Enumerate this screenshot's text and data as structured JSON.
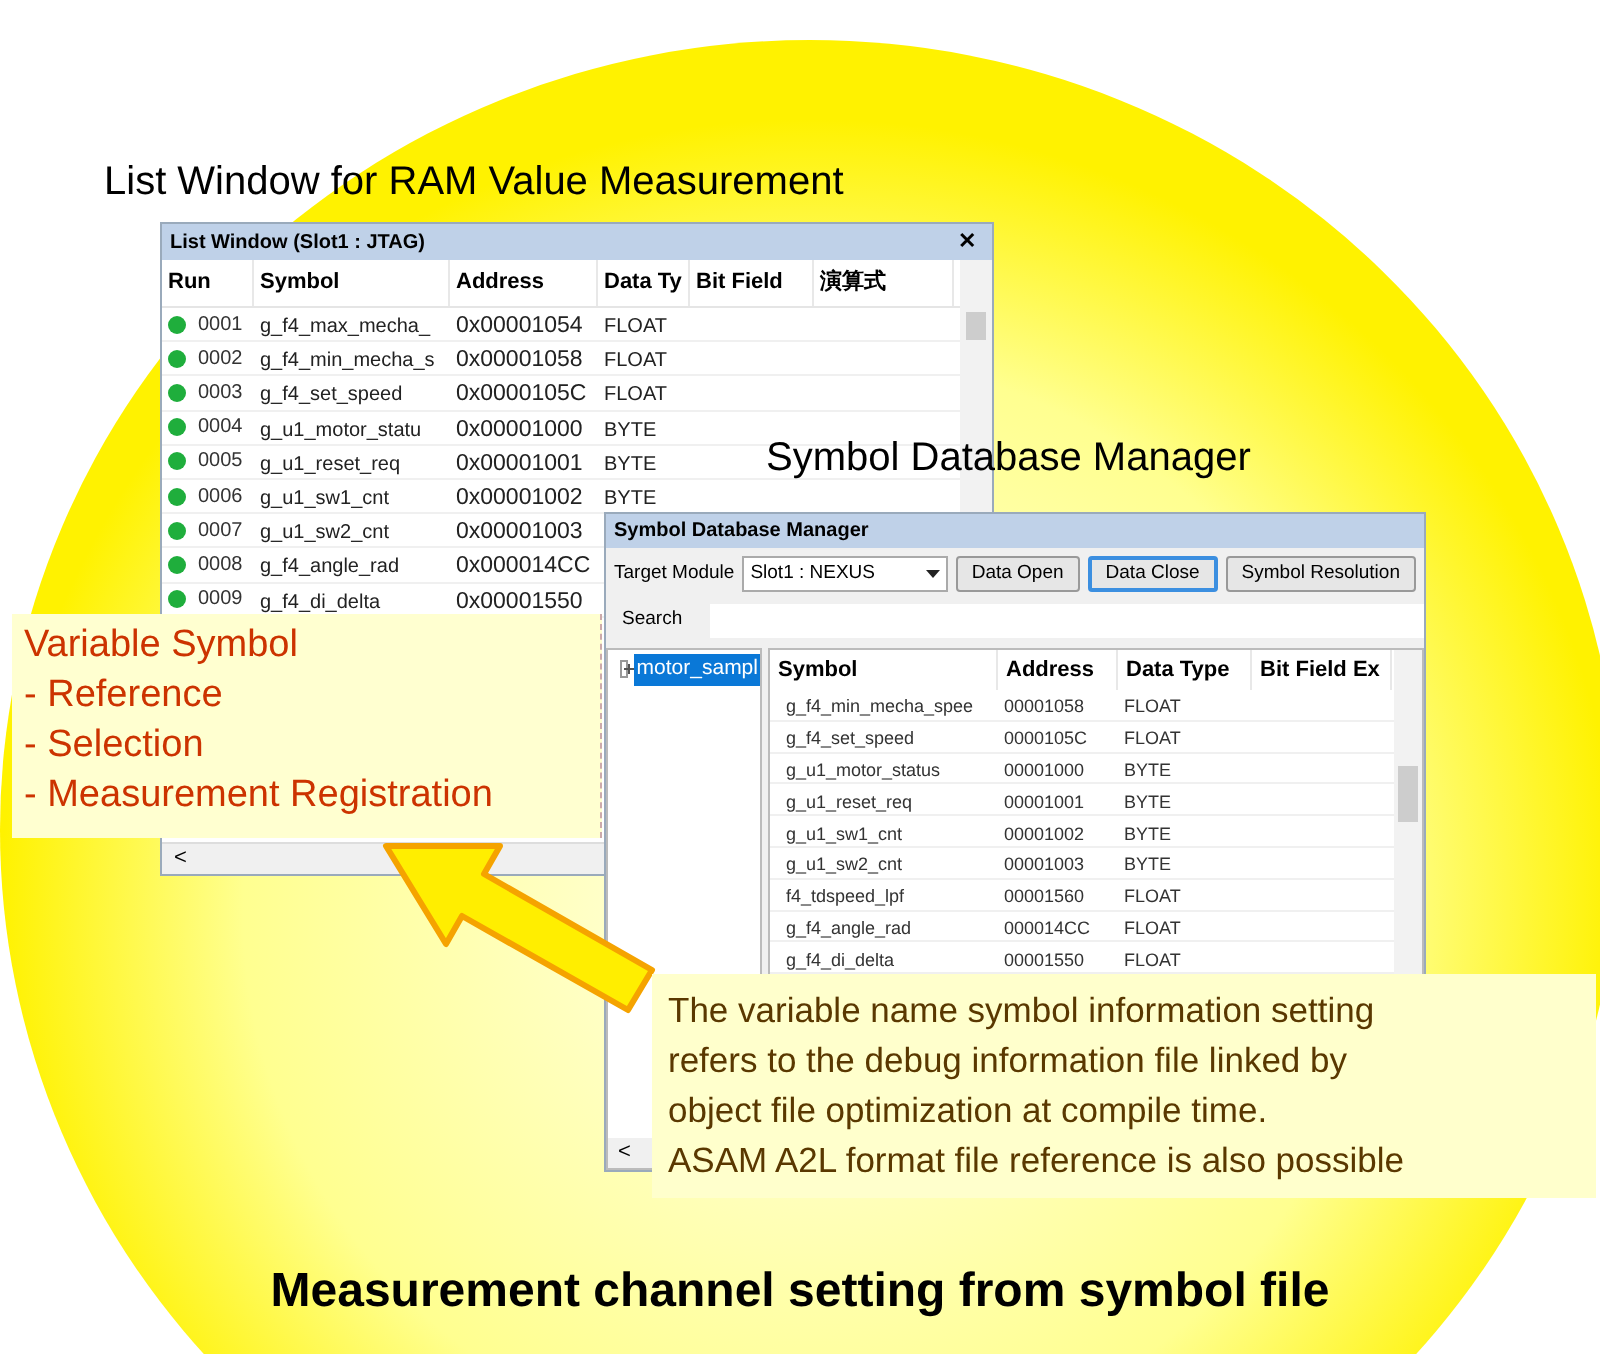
{
  "list_caption": "List Window for RAM Value Measurement",
  "list_window": {
    "title": "List Window (Slot1 : JTAG)",
    "close": "✕",
    "columns": [
      "Run",
      "Symbol",
      "Address",
      "Data Ty",
      "Bit Field",
      "演算式"
    ],
    "rows": [
      {
        "run": "0001",
        "symbol": "g_f4_max_mecha_",
        "address": "0x00001054",
        "data_type": "FLOAT"
      },
      {
        "run": "0002",
        "symbol": "g_f4_min_mecha_s",
        "address": "0x00001058",
        "data_type": "FLOAT"
      },
      {
        "run": "0003",
        "symbol": "g_f4_set_speed",
        "address": "0x0000105C",
        "data_type": "FLOAT"
      },
      {
        "run": "0004",
        "symbol": "g_u1_motor_statu",
        "address": "0x00001000",
        "data_type": "BYTE"
      },
      {
        "run": "0005",
        "symbol": "g_u1_reset_req",
        "address": "0x00001001",
        "data_type": "BYTE"
      },
      {
        "run": "0006",
        "symbol": "g_u1_sw1_cnt",
        "address": "0x00001002",
        "data_type": "BYTE"
      },
      {
        "run": "0007",
        "symbol": "g_u1_sw2_cnt",
        "address": "0x00001003"
      },
      {
        "run": "0008",
        "symbol": "g_f4_angle_rad",
        "address": "0x000014CC"
      },
      {
        "run": "0009",
        "symbol": "g_f4_di_delta",
        "address": "0x00001550"
      }
    ],
    "scroll_left": "<"
  },
  "db_caption": "Symbol Database Manager",
  "db_window": {
    "title": "Symbol Database Manager",
    "target_label": "Target Module",
    "target_value": "Slot1 : NEXUS",
    "buttons": [
      {
        "label": "Data Open",
        "focused": false
      },
      {
        "label": "Data Close",
        "focused": true
      },
      {
        "label": "Symbol Resolution",
        "focused": false
      }
    ],
    "search_label": "Search",
    "tree": [
      {
        "label": "motor_sampl",
        "selected": true,
        "expanded": false
      }
    ],
    "columns": [
      "Symbol",
      "Address",
      "Data Type",
      "Bit Field Ex"
    ],
    "rows": [
      {
        "symbol": "g_f4_min_mecha_spee",
        "address": "00001058",
        "data_type": "FLOAT"
      },
      {
        "symbol": "g_f4_set_speed",
        "address": "0000105C",
        "data_type": "FLOAT"
      },
      {
        "symbol": "g_u1_motor_status",
        "address": "00001000",
        "data_type": "BYTE"
      },
      {
        "symbol": "g_u1_reset_req",
        "address": "00001001",
        "data_type": "BYTE"
      },
      {
        "symbol": "g_u1_sw1_cnt",
        "address": "00001002",
        "data_type": "BYTE"
      },
      {
        "symbol": "g_u1_sw2_cnt",
        "address": "00001003",
        "data_type": "BYTE"
      },
      {
        "symbol": "f4_tdspeed_lpf",
        "address": "00001560",
        "data_type": "FLOAT"
      },
      {
        "symbol": "g_f4_angle_rad",
        "address": "000014CC",
        "data_type": "FLOAT"
      },
      {
        "symbol": "g_f4_di_delta",
        "address": "00001550",
        "data_type": "FLOAT"
      }
    ],
    "scroll_left": "<"
  },
  "feature_callout": {
    "lines": [
      "Variable Symbol",
      "- Reference",
      "- Selection",
      "- Measurement Registration"
    ]
  },
  "note_callout": {
    "lines": [
      "The variable name symbol information setting",
      "refers to the debug information file linked by",
      "object file optimization at compile time.",
      "ASAM A2L format file reference is also possible"
    ]
  },
  "footer_title": "Measurement channel setting from symbol file"
}
